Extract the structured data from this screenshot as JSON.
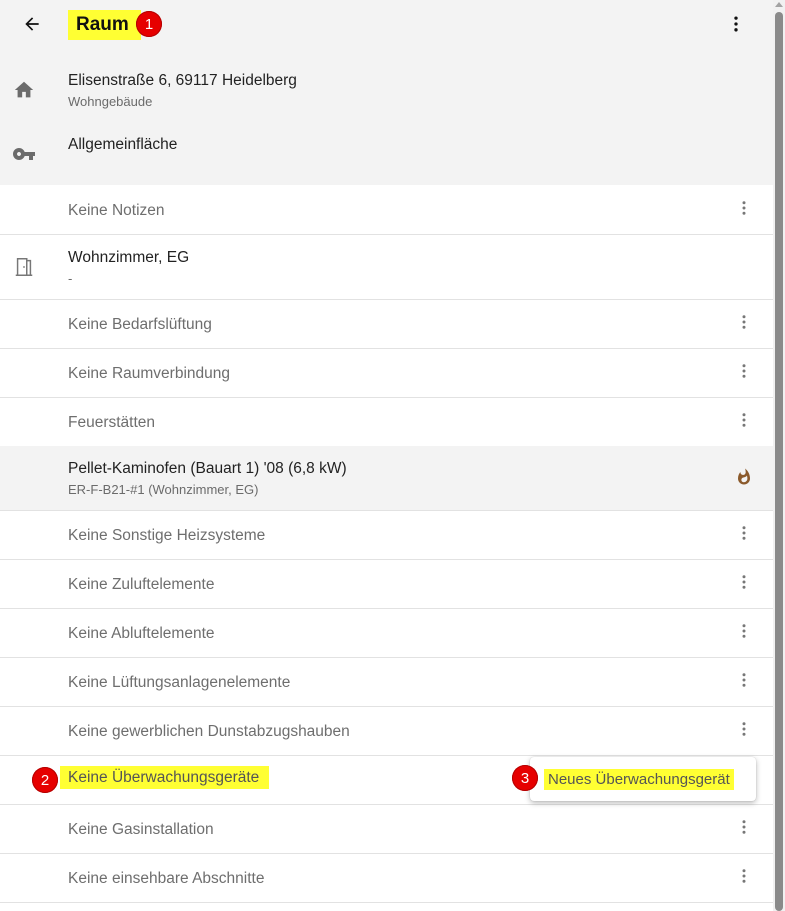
{
  "header": {
    "title": "Raum",
    "back_icon": "arrow-left-icon",
    "menu_icon": "more-vertical-icon"
  },
  "badges": {
    "b1": "1",
    "b2": "2",
    "b3": "3"
  },
  "building": {
    "address": "Elisenstraße 6, 69117 Heidelberg",
    "type": "Wohngebäude",
    "icon": "home-icon"
  },
  "area": {
    "label": "Allgemeinfläche",
    "icon": "key-icon"
  },
  "notes": {
    "label": "Keine Notizen"
  },
  "room": {
    "name": "Wohnzimmer, EG",
    "detail": "-",
    "icon": "door-icon"
  },
  "rows": {
    "bedarfslueftung": "Keine Bedarfslüftung",
    "raumverbindung": "Keine Raumverbindung",
    "feuerstaetten": "Feuerstätten",
    "heizsysteme": "Keine Sonstige Heizsysteme",
    "zuluft": "Keine Zuluftelemente",
    "abluft": "Keine Abluftelemente",
    "lueftungsanlage": "Keine Lüftungsanlagenelemente",
    "dunstabzug": "Keine gewerblichen Dunstabzugshauben",
    "ueberwachung": "Keine Überwachungsgeräte",
    "gasinstallation": "Keine Gasinstallation",
    "abschnitte": "Keine einsehbare Abschnitte"
  },
  "fireplace": {
    "title": "Pellet-Kaminofen (Bauart 1) '08 (6,8 kW)",
    "subtitle": "ER-F-B21-#1 (Wohnzimmer, EG)",
    "icon": "flame-icon"
  },
  "popup": {
    "label": "Neues Überwachungsgerät"
  },
  "colors": {
    "highlight": "#ffff33",
    "badge": "#e60000",
    "flame": "#8b5a2b"
  }
}
